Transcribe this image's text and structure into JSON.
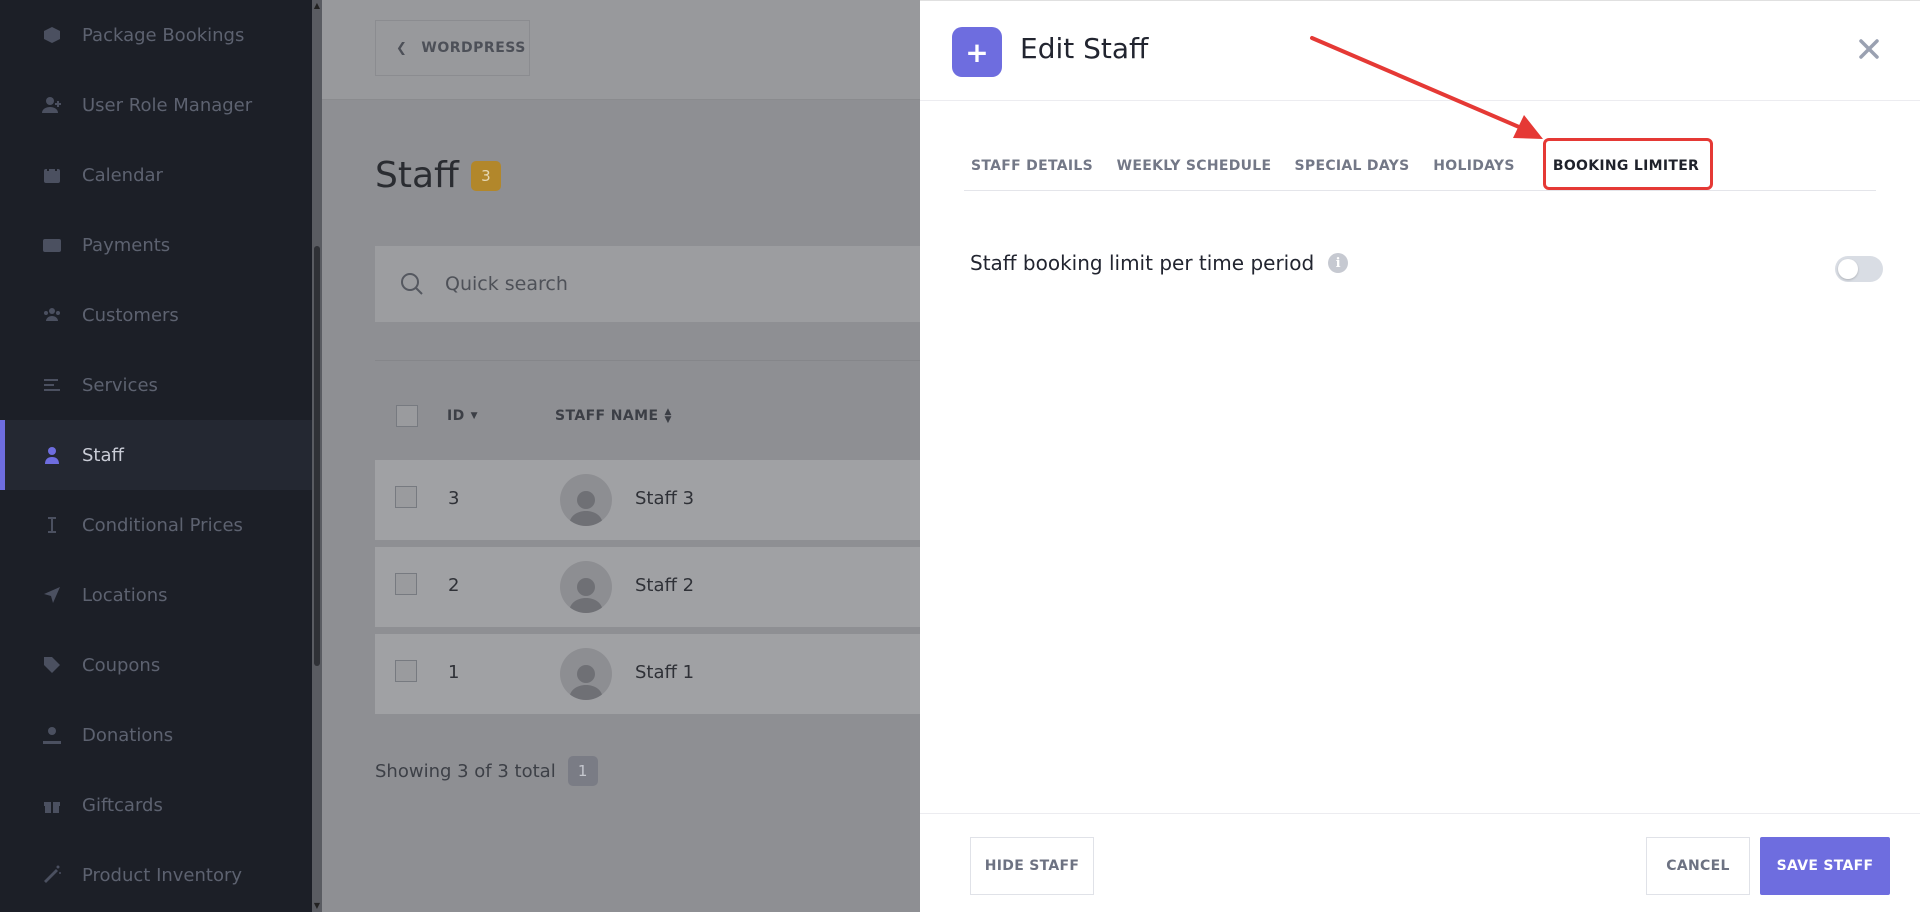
{
  "sidebar": {
    "items": [
      {
        "label": "Package Bookings",
        "icon": "package-icon"
      },
      {
        "label": "User Role Manager",
        "icon": "user-plus-icon"
      },
      {
        "label": "Calendar",
        "icon": "calendar-icon"
      },
      {
        "label": "Payments",
        "icon": "wallet-icon"
      },
      {
        "label": "Customers",
        "icon": "users-icon"
      },
      {
        "label": "Services",
        "icon": "list-icon"
      },
      {
        "label": "Staff",
        "icon": "user-icon",
        "active": true
      },
      {
        "label": "Conditional Prices",
        "icon": "cursor-icon"
      },
      {
        "label": "Locations",
        "icon": "location-arrow-icon"
      },
      {
        "label": "Coupons",
        "icon": "tag-icon"
      },
      {
        "label": "Donations",
        "icon": "hand-heart-icon"
      },
      {
        "label": "Giftcards",
        "icon": "gift-icon"
      },
      {
        "label": "Product Inventory",
        "icon": "magic-wand-icon"
      }
    ]
  },
  "main": {
    "back_label": "WORDPRESS",
    "title": "Staff",
    "count": "3",
    "search_placeholder": "Quick search",
    "columns": {
      "id": "ID",
      "name": "STAFF NAME"
    },
    "rows": [
      {
        "id": "3",
        "name": "Staff 3"
      },
      {
        "id": "2",
        "name": "Staff 2"
      },
      {
        "id": "1",
        "name": "Staff 1"
      }
    ],
    "footer_text": "Showing 3 of 3 total",
    "page": "1"
  },
  "drawer": {
    "plus": "+",
    "title": "Edit Staff",
    "tabs": [
      "STAFF DETAILS",
      "WEEKLY SCHEDULE",
      "SPECIAL DAYS",
      "HOLIDAYS",
      "BOOKING LIMITER"
    ],
    "active_tab": "BOOKING LIMITER",
    "setting_label": "Staff booking limit per time period",
    "info": "i",
    "toggle_on": false,
    "buttons": {
      "hide": "HIDE STAFF",
      "cancel": "CANCEL",
      "save": "SAVE STAFF"
    }
  },
  "colors": {
    "accent": "#6e6ddf",
    "sidebar_bg": "#1c1f27",
    "annotation": "#e53935",
    "badge": "#b2872b"
  }
}
